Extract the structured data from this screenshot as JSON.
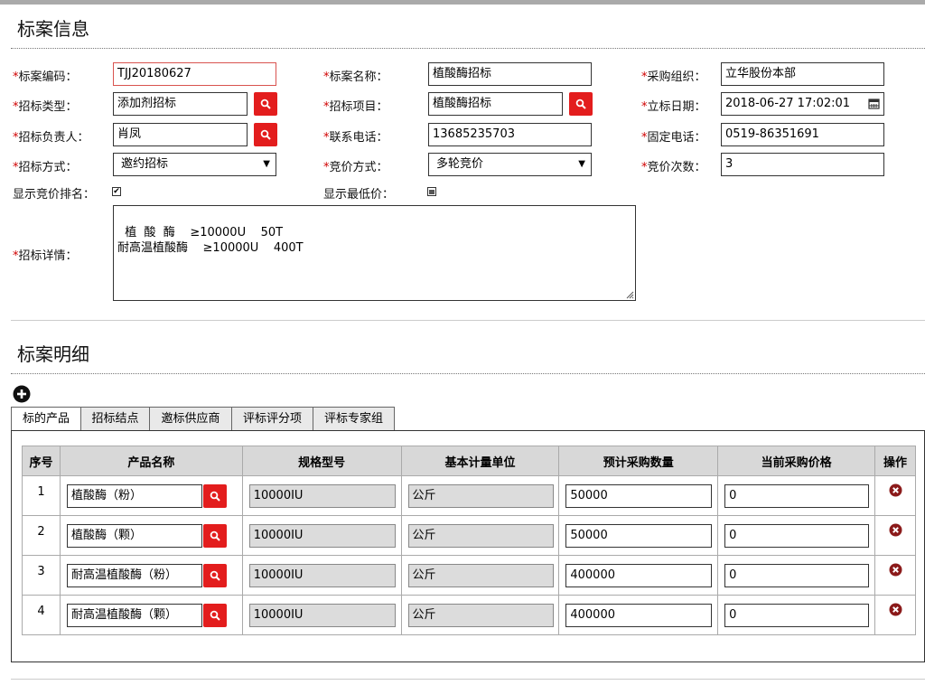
{
  "sections": {
    "info_title": "标案信息",
    "detail_title": "标案明细"
  },
  "form": {
    "code": {
      "label": "标案编码：",
      "value": "TJJ20180627"
    },
    "name": {
      "label": "标案名称：",
      "value": "植酸酶招标"
    },
    "org": {
      "label": "采购组织：",
      "value": "立华股份本部"
    },
    "type": {
      "label": "招标类型：",
      "value": "添加剂招标"
    },
    "project": {
      "label": "招标项目：",
      "value": "植酸酶招标"
    },
    "date": {
      "label": "立标日期：",
      "value": "2018-06-27 17:02:01"
    },
    "owner": {
      "label": "招标负责人：",
      "value": "肖凤"
    },
    "phone": {
      "label": "联系电话：",
      "value": "13685235703"
    },
    "tel": {
      "label": "固定电话：",
      "value": "0519-86351691"
    },
    "method": {
      "label": "招标方式：",
      "value": "邀约招标"
    },
    "bid_mode": {
      "label": "竞价方式：",
      "value": "多轮竞价"
    },
    "bid_times": {
      "label": "竞价次数：",
      "value": "3"
    },
    "show_rank": {
      "label": "显示竞价排名：",
      "checked": true
    },
    "show_min": {
      "label": "显示最低价：",
      "checked": false
    },
    "details": {
      "label": "招标详情：",
      "value": "植  酸  酶    ≥10000U    50T\n耐高温植酸酶    ≥10000U    400T"
    },
    "required_mark": "*"
  },
  "tabs": [
    "标的产品",
    "招标结点",
    "邀标供应商",
    "评标评分项",
    "评标专家组"
  ],
  "table": {
    "headers": [
      "序号",
      "产品名称",
      "规格型号",
      "基本计量单位",
      "预计采购数量",
      "当前采购价格",
      "操作"
    ],
    "rows": [
      {
        "seq": "1",
        "product": "植酸酶（粉）",
        "spec": "10000IU",
        "unit": "公斤",
        "qty": "50000",
        "price": "0"
      },
      {
        "seq": "2",
        "product": "植酸酶（颗）",
        "spec": "10000IU",
        "unit": "公斤",
        "qty": "50000",
        "price": "0"
      },
      {
        "seq": "3",
        "product": "耐高温植酸酶（粉）",
        "spec": "10000IU",
        "unit": "公斤",
        "qty": "400000",
        "price": "0"
      },
      {
        "seq": "4",
        "product": "耐高温植酸酶（颗）",
        "spec": "10000IU",
        "unit": "公斤",
        "qty": "400000",
        "price": "0"
      }
    ]
  },
  "icons": {
    "search": "search-icon",
    "calendar": "calendar-icon",
    "add": "add-circle-icon",
    "delete": "delete-circle-icon",
    "dropdown": "chevron-down-icon"
  },
  "colors": {
    "accent_red": "#e31d1d",
    "required_red": "#d00000",
    "header_gray": "#d8d8d8",
    "readonly_gray": "#dcdcdc"
  }
}
